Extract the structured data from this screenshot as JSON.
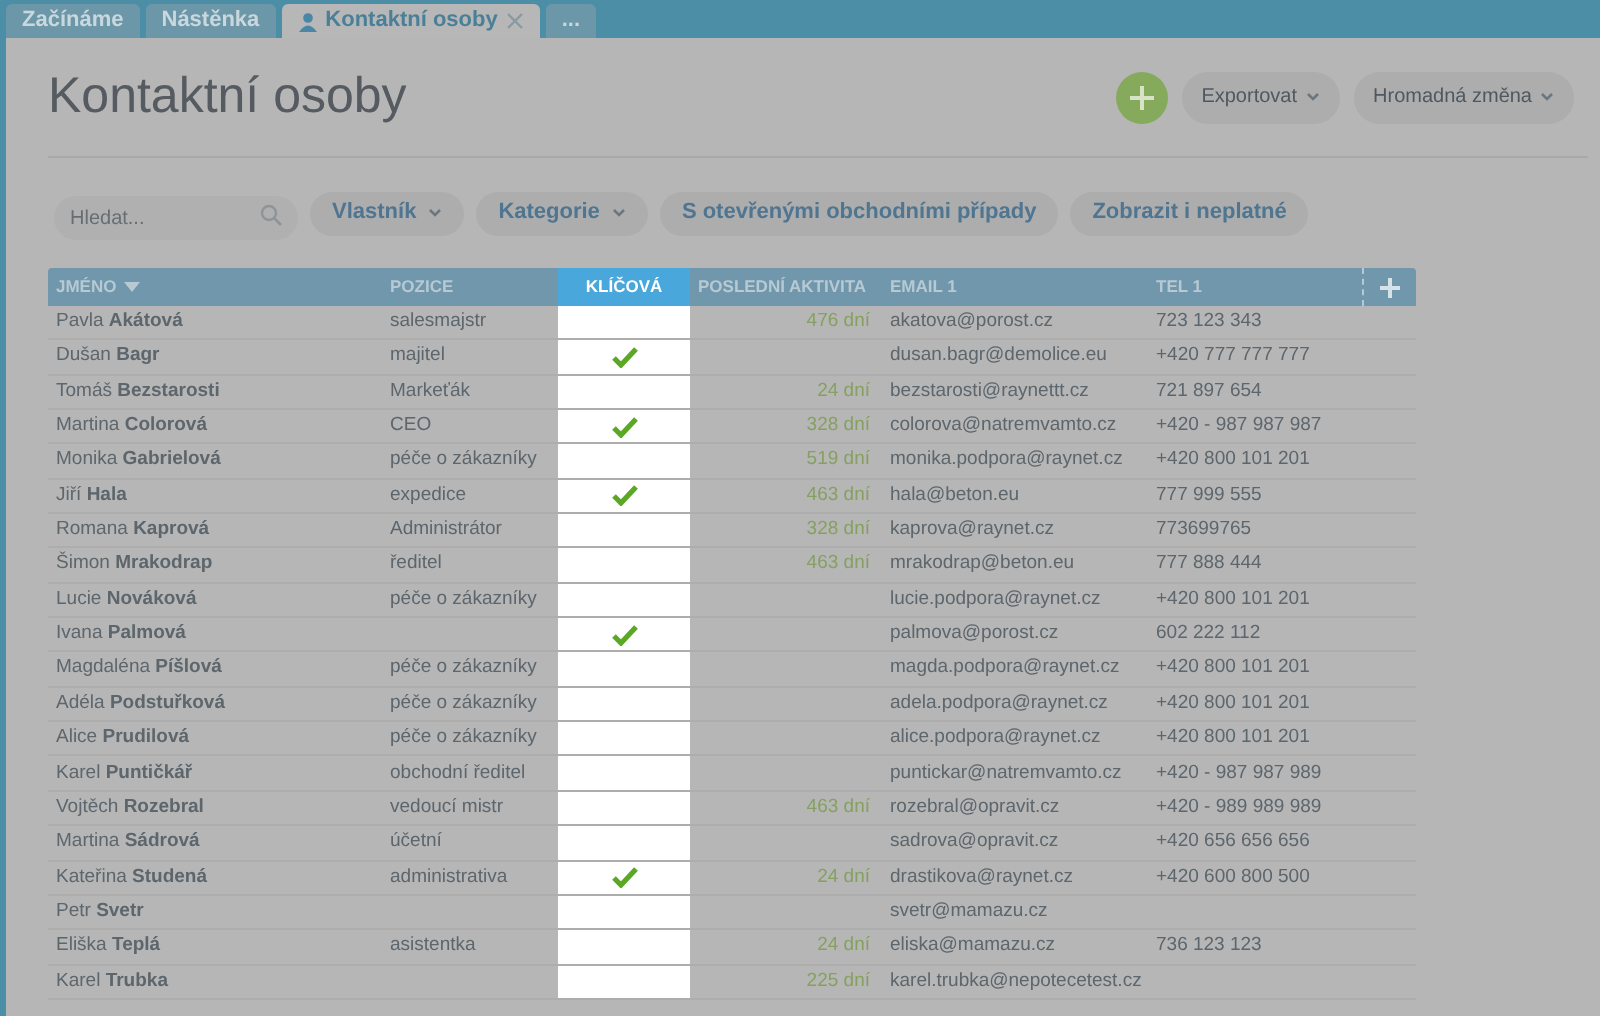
{
  "tabs": [
    {
      "label": "Začínáme",
      "selected": false,
      "icon": false,
      "closable": false
    },
    {
      "label": "Nástěnka",
      "selected": false,
      "icon": false,
      "closable": false
    },
    {
      "label": "Kontaktní osoby",
      "selected": true,
      "icon": true,
      "closable": true
    },
    {
      "label": "...",
      "selected": false,
      "icon": false,
      "closable": false
    }
  ],
  "title": "Kontaktní osoby",
  "actions": [
    {
      "label": "Exportovat"
    },
    {
      "label": "Hromadná změna"
    }
  ],
  "search": {
    "placeholder": "Hledat..."
  },
  "filters": [
    {
      "label": "Vlastník",
      "dropdown": true
    },
    {
      "label": "Kategorie",
      "dropdown": true
    },
    {
      "label": "S otevřenými obchodními případy",
      "dropdown": false
    },
    {
      "label": "Zobrazit i neplatné",
      "dropdown": false
    }
  ],
  "table": {
    "columns": [
      {
        "label": "JMÉNO",
        "sorted": true,
        "selected": false
      },
      {
        "label": "POZICE",
        "sorted": false,
        "selected": false
      },
      {
        "label": "KLÍČOVÁ",
        "sorted": false,
        "selected": true
      },
      {
        "label": "POSLEDNÍ AKTIVITA",
        "sorted": false,
        "selected": false
      },
      {
        "label": "EMAIL 1",
        "sorted": false,
        "selected": false
      },
      {
        "label": "TEL 1",
        "sorted": false,
        "selected": false
      }
    ],
    "rows": [
      {
        "name": "Pavla **Akátová**",
        "position": "salesmajstr",
        "key": false,
        "activity": "476 dní",
        "email": "akatova@porost.cz",
        "tel": "723 123 343"
      },
      {
        "name": "Dušan **Bagr**",
        "position": "majitel",
        "key": true,
        "activity": "",
        "email": "dusan.bagr@demolice.eu",
        "tel": "+420 777 777 777"
      },
      {
        "name": "Tomáš **Bezstarosti**",
        "position": "Markeťák",
        "key": false,
        "activity": "24 dní",
        "email": "bezstarosti@raynettt.cz",
        "tel": "721 897 654"
      },
      {
        "name": "Martina **Colorová**",
        "position": "CEO",
        "key": true,
        "activity": "328 dní",
        "email": "colorova@natremvamto.cz",
        "tel": "+420 - 987 987 987"
      },
      {
        "name": "Monika **Gabrielová**",
        "position": "péče o zákazníky",
        "key": false,
        "activity": "519 dní",
        "email": "monika.podpora@raynet.cz",
        "tel": "+420 800 101 201"
      },
      {
        "name": "Jiří **Hala**",
        "position": "expedice",
        "key": true,
        "activity": "463 dní",
        "email": "hala@beton.eu",
        "tel": "777 999 555"
      },
      {
        "name": "Romana **Kaprová**",
        "position": "Administrátor",
        "key": false,
        "activity": "328 dní",
        "email": "kaprova@raynet.cz",
        "tel": "773699765"
      },
      {
        "name": "Šimon **Mrakodrap**",
        "position": "ředitel",
        "key": false,
        "activity": "463 dní",
        "email": "mrakodrap@beton.eu",
        "tel": "777 888 444"
      },
      {
        "name": "Lucie **Nováková**",
        "position": "péče o zákazníky",
        "key": false,
        "activity": "",
        "email": "lucie.podpora@raynet.cz",
        "tel": "+420 800 101 201"
      },
      {
        "name": "Ivana **Palmová**",
        "position": "",
        "key": true,
        "activity": "",
        "email": "palmova@porost.cz",
        "tel": "602 222 112"
      },
      {
        "name": "Magdaléna **Píšlová**",
        "position": "péče o zákazníky",
        "key": false,
        "activity": "",
        "email": "magda.podpora@raynet.cz",
        "tel": "+420 800 101 201"
      },
      {
        "name": "Adéla **Podstuřková**",
        "position": "péče o zákazníky",
        "key": false,
        "activity": "",
        "email": "adela.podpora@raynet.cz",
        "tel": "+420 800 101 201"
      },
      {
        "name": "Alice **Prudilová**",
        "position": "péče o zákazníky",
        "key": false,
        "activity": "",
        "email": "alice.podpora@raynet.cz",
        "tel": "+420 800 101 201"
      },
      {
        "name": "Karel **Puntičkář**",
        "position": "obchodní ředitel",
        "key": false,
        "activity": "",
        "email": "puntickar@natremvamto.cz",
        "tel": "+420 - 987 987 989"
      },
      {
        "name": "Vojtěch **Rozebral**",
        "position": "vedoucí mistr",
        "key": false,
        "activity": "463 dní",
        "email": "rozebral@opravit.cz",
        "tel": "+420 - 989 989 989"
      },
      {
        "name": "Martina **Sádrová**",
        "position": "účetní",
        "key": false,
        "activity": "",
        "email": "sadrova@opravit.cz",
        "tel": "+420 656 656 656"
      },
      {
        "name": "Kateřina **Studená**",
        "position": "administrativa",
        "key": true,
        "activity": "24 dní",
        "email": "drastikova@raynet.cz",
        "tel": "+420 600 800 500"
      },
      {
        "name": "Petr **Svetr**",
        "position": "",
        "key": false,
        "activity": "",
        "email": "svetr@mamazu.cz",
        "tel": ""
      },
      {
        "name": "Eliška **Teplá**",
        "position": "asistentka",
        "key": false,
        "activity": "24 dní",
        "email": "eliska@mamazu.cz",
        "tel": "736 123 123"
      },
      {
        "name": "Karel **Trubka**",
        "position": "",
        "key": false,
        "activity": "225 dní",
        "email": "karel.trubka@nepotecetest.cz",
        "tel": ""
      }
    ]
  }
}
